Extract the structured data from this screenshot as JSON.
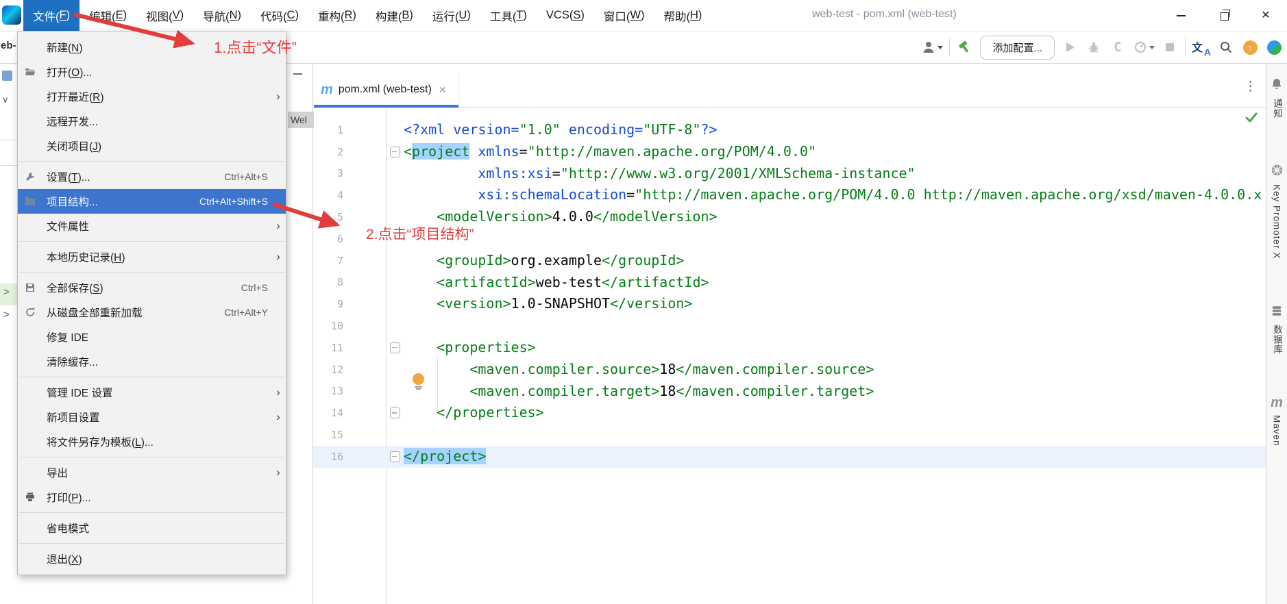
{
  "titlebar": {
    "title": "web-test - pom.xml (web-test)",
    "menus": [
      {
        "label": "文件(F)",
        "active": true
      },
      {
        "label": "编辑(E)"
      },
      {
        "label": "视图(V)"
      },
      {
        "label": "导航(N)"
      },
      {
        "label": "代码(C)"
      },
      {
        "label": "重构(R)"
      },
      {
        "label": "构建(B)"
      },
      {
        "label": "运行(U)"
      },
      {
        "label": "工具(T)"
      },
      {
        "label": "VCS(S)"
      },
      {
        "label": "窗口(W)"
      },
      {
        "label": "帮助(H)"
      }
    ],
    "window_controls": [
      "minimize-icon",
      "restore-icon",
      "close-icon"
    ],
    "close_glyph": "✕"
  },
  "toolbar": {
    "breadcrumb_fragment": "eb-",
    "add_configuration": "添加配置...",
    "icons": [
      "user",
      "divider",
      "build-hammer",
      "add-config-button",
      "run",
      "debug",
      "coverage",
      "profiler",
      "stop",
      "divider",
      "translate",
      "search",
      "update-arrow",
      "gradient-sphere"
    ]
  },
  "file_menu": {
    "items": [
      {
        "label": "新建(N)"
      },
      {
        "label": "打开(O)...",
        "icon": "folder-open"
      },
      {
        "label": "打开最近(R)",
        "submenu": true
      },
      {
        "label": "远程开发..."
      },
      {
        "label": "关闭项目(J)"
      },
      {
        "separator": true
      },
      {
        "label": "设置(T)...",
        "icon": "wrench",
        "shortcut": "Ctrl+Alt+S"
      },
      {
        "label": "项目结构...",
        "icon": "project-structure",
        "shortcut": "Ctrl+Alt+Shift+S",
        "highlighted": true
      },
      {
        "label": "文件属性",
        "submenu": true
      },
      {
        "separator": true
      },
      {
        "label": "本地历史记录(H)",
        "submenu": true
      },
      {
        "separator": true
      },
      {
        "label": "全部保存(S)",
        "icon": "save",
        "shortcut": "Ctrl+S"
      },
      {
        "label": "从磁盘全部重新加载",
        "icon": "refresh",
        "shortcut": "Ctrl+Alt+Y"
      },
      {
        "label": "修复 IDE"
      },
      {
        "label": "清除缓存..."
      },
      {
        "separator": true
      },
      {
        "label": "管理 IDE 设置",
        "submenu": true
      },
      {
        "label": "新项目设置",
        "submenu": true
      },
      {
        "label": "将文件另存为模板(L)..."
      },
      {
        "separator": true
      },
      {
        "label": "导出",
        "submenu": true
      },
      {
        "label": "打印(P)...",
        "icon": "printer"
      },
      {
        "separator": true
      },
      {
        "label": "省电模式"
      },
      {
        "separator": true
      },
      {
        "label": "退出(X)"
      }
    ]
  },
  "editor": {
    "panel_fragment": "Wel",
    "tab": {
      "icon": "maven-m-icon",
      "label": "pom.xml (web-test)",
      "close_glyph": "✕"
    },
    "right_actions": [
      "more-vertical-icon",
      "inspections-ok-icon"
    ],
    "lines": [
      {
        "n": 1,
        "seg": [
          {
            "t": "<?xml version=",
            "c": "attr"
          },
          {
            "t": "\"1.0\"",
            "c": "val"
          },
          {
            "t": " encoding=",
            "c": "attr"
          },
          {
            "t": "\"UTF-8\"",
            "c": "val"
          },
          {
            "t": "?>",
            "c": "attr"
          }
        ]
      },
      {
        "n": 2,
        "fold": true,
        "seg": [
          {
            "t": "<",
            "c": "tag"
          },
          {
            "t": "project",
            "c": "tag",
            "h": true
          },
          {
            "t": " ",
            "c": "plain"
          },
          {
            "t": "xmlns",
            "c": "attr"
          },
          {
            "t": "=",
            "c": "plain"
          },
          {
            "t": "\"http://maven.apache.org/POM/4.0.0\"",
            "c": "val"
          }
        ]
      },
      {
        "n": 3,
        "seg": [
          {
            "t": "         ",
            "c": "plain"
          },
          {
            "t": "xmlns:xsi",
            "c": "attr"
          },
          {
            "t": "=",
            "c": "plain"
          },
          {
            "t": "\"http://www.w3.org/2001/XMLSchema-instance\"",
            "c": "val"
          }
        ]
      },
      {
        "n": 4,
        "seg": [
          {
            "t": "         ",
            "c": "plain"
          },
          {
            "t": "xsi:schemaLocation",
            "c": "attr"
          },
          {
            "t": "=",
            "c": "plain"
          },
          {
            "t": "\"http://maven.apache.org/POM/4.0.0 http://maven.apache.org/xsd/maven-4.0.0.x",
            "c": "val"
          }
        ]
      },
      {
        "n": 5,
        "seg": [
          {
            "t": "    ",
            "c": "plain"
          },
          {
            "t": "<modelVersion>",
            "c": "tag"
          },
          {
            "t": "4.0.0",
            "c": "plain"
          },
          {
            "t": "</modelVersion>",
            "c": "tag"
          }
        ]
      },
      {
        "n": 6,
        "seg": []
      },
      {
        "n": 7,
        "seg": [
          {
            "t": "    ",
            "c": "plain"
          },
          {
            "t": "<groupId>",
            "c": "tag"
          },
          {
            "t": "org.example",
            "c": "plain"
          },
          {
            "t": "</groupId>",
            "c": "tag"
          }
        ]
      },
      {
        "n": 8,
        "seg": [
          {
            "t": "    ",
            "c": "plain"
          },
          {
            "t": "<artifactId>",
            "c": "tag"
          },
          {
            "t": "web-test",
            "c": "plain"
          },
          {
            "t": "</artifactId>",
            "c": "tag"
          }
        ]
      },
      {
        "n": 9,
        "seg": [
          {
            "t": "    ",
            "c": "plain"
          },
          {
            "t": "<version>",
            "c": "tag"
          },
          {
            "t": "1.0-SNAPSHOT",
            "c": "plain"
          },
          {
            "t": "</version>",
            "c": "tag"
          }
        ]
      },
      {
        "n": 10,
        "seg": []
      },
      {
        "n": 11,
        "fold": true,
        "seg": [
          {
            "t": "    ",
            "c": "plain"
          },
          {
            "t": "<properties>",
            "c": "tag"
          }
        ]
      },
      {
        "n": 12,
        "seg": [
          {
            "t": "        ",
            "c": "plain"
          },
          {
            "t": "<maven.compiler.source>",
            "c": "tag"
          },
          {
            "t": "18",
            "c": "plain"
          },
          {
            "t": "</maven.compiler.source>",
            "c": "tag"
          }
        ]
      },
      {
        "n": 13,
        "seg": [
          {
            "t": "        ",
            "c": "plain"
          },
          {
            "t": "<maven.compiler.target>",
            "c": "tag"
          },
          {
            "t": "18",
            "c": "plain"
          },
          {
            "t": "</maven.compiler.target>",
            "c": "tag"
          }
        ]
      },
      {
        "n": 14,
        "fold": true,
        "seg": [
          {
            "t": "    ",
            "c": "plain"
          },
          {
            "t": "</properties>",
            "c": "tag"
          }
        ]
      },
      {
        "n": 15,
        "bulb": true,
        "seg": []
      },
      {
        "n": 16,
        "fold": true,
        "current": true,
        "seg": [
          {
            "t": "</project>",
            "c": "tag",
            "h": true
          }
        ]
      }
    ]
  },
  "annotations": {
    "step1": "1.点击“文件”",
    "step2": "2.点击“项目结构”"
  },
  "sidebar_right": [
    {
      "icon": "bell-icon",
      "label": "通知"
    },
    {
      "icon": "key-promoter-icon",
      "label": "Key Promoter X"
    },
    {
      "icon": "database-icon",
      "label": "数据库"
    },
    {
      "icon": "maven-m-icon",
      "label": "Maven"
    }
  ],
  "colors": {
    "accent_blue": "#3B77D7",
    "menu_highlight": "#3D74CE",
    "menubar_highlight": "#1E70C1",
    "annotation_red": "#E23C3C",
    "xml_tag": "#067D17",
    "xml_attr": "#174AD4",
    "xml_value": "#067D17",
    "selection": "#A6D2FF",
    "caret_row": "#EAF3FD",
    "line_number": "#ABABAB",
    "maven_blue": "#56ABE0",
    "hammer_green": "#57A64A",
    "update_orange": "#F2A63C"
  }
}
